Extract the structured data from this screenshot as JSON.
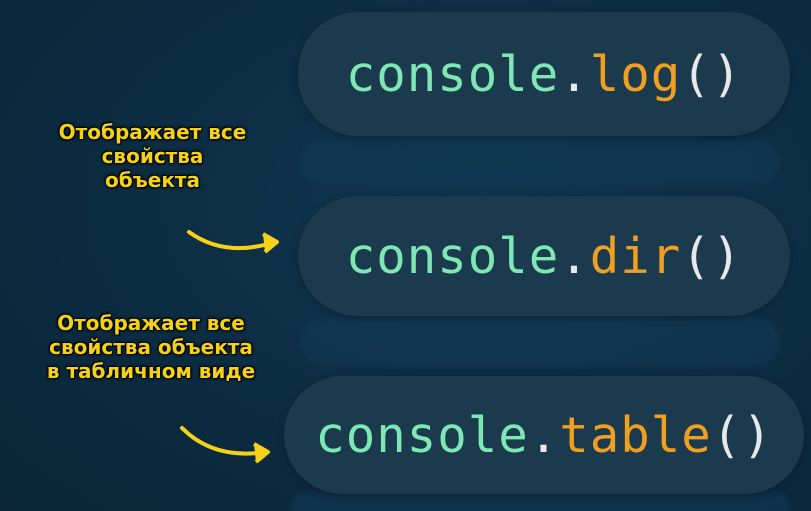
{
  "items": [
    {
      "object": "console",
      "dot": ".",
      "method": "log",
      "parens": "()"
    },
    {
      "object": "console",
      "dot": ".",
      "method": "dir",
      "parens": "()"
    },
    {
      "object": "console",
      "dot": ".",
      "method": "table",
      "parens": "()"
    }
  ],
  "annotations": {
    "dir_note": {
      "line1": "Отображает все",
      "line2": "свойства",
      "line3": "объекта"
    },
    "table_note": {
      "line1": "Отображает все",
      "line2": "свойства объекта",
      "line3": "в табличном виде"
    }
  },
  "colors": {
    "background": "#0c2b40",
    "pill": "#1c3a4e",
    "object_text": "#7ee8b4",
    "method_text": "#f0a020",
    "punctuation": "#e8e8e8",
    "annotation": "#f5d21a"
  }
}
